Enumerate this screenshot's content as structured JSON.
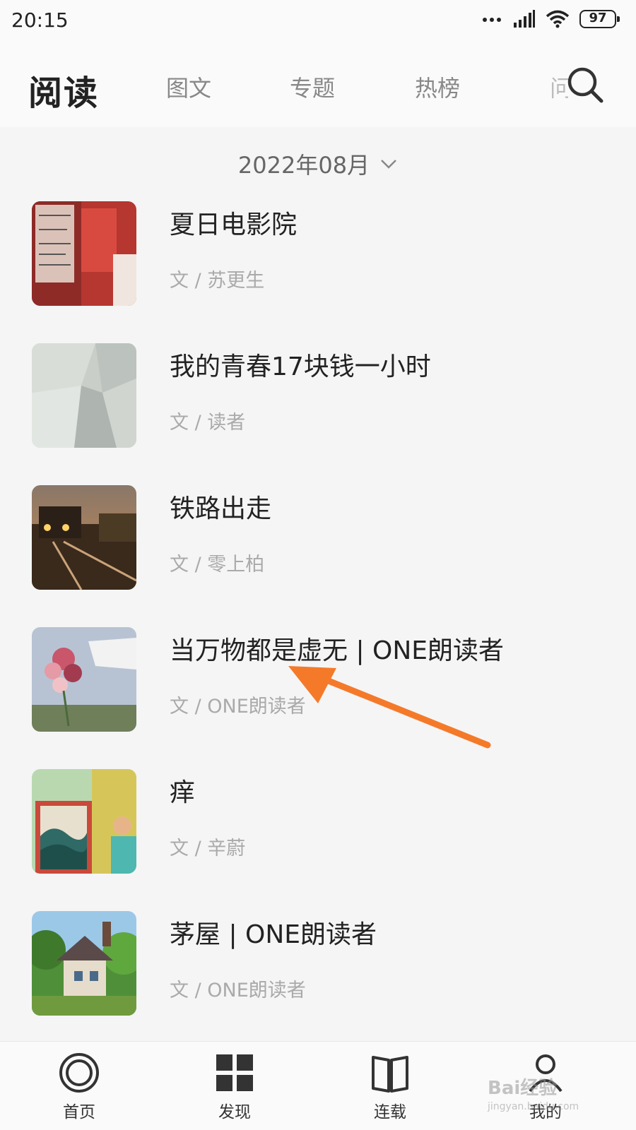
{
  "status_bar": {
    "time": "20:15",
    "battery": "97"
  },
  "header": {
    "title": "阅读",
    "tabs": [
      {
        "label": "图文"
      },
      {
        "label": "专题"
      },
      {
        "label": "热榜"
      },
      {
        "label": "问"
      }
    ]
  },
  "month_selector": {
    "label": "2022年08月"
  },
  "articles": [
    {
      "title": "夏日电影院",
      "author": "文 / 苏更生"
    },
    {
      "title": "我的青春17块钱一小时",
      "author": "文 / 读者"
    },
    {
      "title": "铁路出走",
      "author": "文 / 零上柏"
    },
    {
      "title": "当万物都是虚无 | ONE朗读者",
      "author": "文 / ONE朗读者"
    },
    {
      "title": "痒",
      "author": "文 / 辛蔚"
    },
    {
      "title": "茅屋 | ONE朗读者",
      "author": "文 / ONE朗读者"
    }
  ],
  "bottom_nav": [
    {
      "label": "首页",
      "icon": "home-circle-icon"
    },
    {
      "label": "发现",
      "icon": "grid-icon"
    },
    {
      "label": "连载",
      "icon": "book-icon"
    },
    {
      "label": "我的",
      "icon": "person-icon"
    }
  ],
  "watermark": {
    "text": "Bai经验",
    "sub": "jingyan.baidu.com"
  },
  "colors": {
    "arrow": "#f47a2a",
    "background": "#f5f5f5"
  }
}
